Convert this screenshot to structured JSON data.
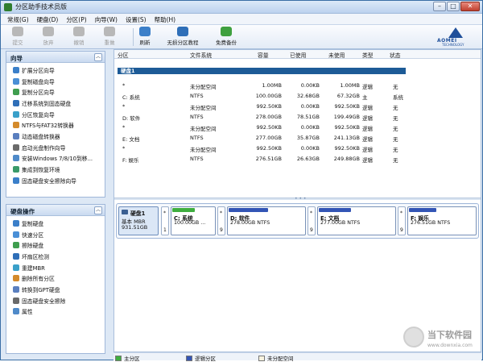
{
  "window": {
    "title": "分区助手技术员版"
  },
  "menu": [
    "常规(G)",
    "硬盘(D)",
    "分区(P)",
    "向导(W)",
    "设置(S)",
    "帮助(H)"
  ],
  "toolbar": {
    "items": [
      {
        "label": "提交",
        "icon": "check-icon",
        "enabled": false
      },
      {
        "label": "放弃",
        "icon": "discard-icon",
        "enabled": false
      },
      {
        "label": "撤销",
        "icon": "undo-icon",
        "enabled": false
      },
      {
        "label": "重做",
        "icon": "redo-icon",
        "enabled": false
      },
      {
        "label": "刷新",
        "icon": "refresh-icon",
        "enabled": true
      },
      {
        "label": "无损分区教程",
        "icon": "tutorial-icon",
        "enabled": true
      },
      {
        "label": "免费备份",
        "icon": "backup-icon",
        "enabled": true
      }
    ],
    "brand": {
      "name": "AOMEI",
      "sub": "TECHNOLOGY"
    }
  },
  "wizard_panel": {
    "title": "向导",
    "items": [
      "扩展分区向导",
      "复制磁盘向导",
      "复制分区向导",
      "迁移系统到固态硬盘",
      "分区恢复向导",
      "NTFS与FAT32转换器",
      "动态磁盘转换器",
      "启动光盘制作向导",
      "安装Windows 7/8/10到移...",
      "集成到恢复环境",
      "固态硬盘安全擦除向导"
    ]
  },
  "disk_ops_panel": {
    "title": "硬盘操作",
    "items": [
      "复制硬盘",
      "快速分区",
      "擦除硬盘",
      "坏扇区检测",
      "重建MBR",
      "删除所有分区",
      "转换到GPT硬盘",
      "固态硬盘安全擦除",
      "属性"
    ]
  },
  "table": {
    "headers": [
      "分区",
      "文件系统",
      "容量",
      "已使用",
      "未使用",
      "类型",
      "状态"
    ],
    "disk_label": "硬盘1",
    "rows": [
      {
        "partition": "*",
        "fs": "未分配空间",
        "capacity": "1.00MB",
        "used": "0.00KB",
        "unused": "1.00MB",
        "type": "逻辑",
        "status": "无"
      },
      {
        "partition": "C: 系统",
        "fs": "NTFS",
        "capacity": "100.00GB",
        "used": "32.68GB",
        "unused": "67.32GB",
        "type": "主",
        "status": "系统"
      },
      {
        "partition": "*",
        "fs": "未分配空间",
        "capacity": "992.50KB",
        "used": "0.00KB",
        "unused": "992.50KB",
        "type": "逻辑",
        "status": "无"
      },
      {
        "partition": "D: 软件",
        "fs": "NTFS",
        "capacity": "278.00GB",
        "used": "78.51GB",
        "unused": "199.49GB",
        "type": "逻辑",
        "status": "无"
      },
      {
        "partition": "*",
        "fs": "未分配空间",
        "capacity": "992.50KB",
        "used": "0.00KB",
        "unused": "992.50KB",
        "type": "逻辑",
        "status": "无"
      },
      {
        "partition": "E: 文档",
        "fs": "NTFS",
        "capacity": "277.00GB",
        "used": "35.87GB",
        "unused": "241.13GB",
        "type": "逻辑",
        "status": "无"
      },
      {
        "partition": "*",
        "fs": "未分配空间",
        "capacity": "992.50KB",
        "used": "0.00KB",
        "unused": "992.50KB",
        "type": "逻辑",
        "status": "无"
      },
      {
        "partition": "F: 娱乐",
        "fs": "NTFS",
        "capacity": "276.51GB",
        "used": "26.63GB",
        "unused": "249.88GB",
        "type": "逻辑",
        "status": "无"
      }
    ]
  },
  "disk_map": {
    "disk_name": "硬盘1",
    "disk_type": "基本 MBR",
    "disk_size": "931.51GB",
    "unalloc_top": "*",
    "unalloc_num_1": "1",
    "unalloc_num_9": "9",
    "partitions": [
      {
        "name": "C: 系统",
        "size": "100.00GB ...",
        "fill": 0.33,
        "color": "#3fae3f"
      },
      {
        "name": "D: 软件",
        "size": "278.00GB NTFS",
        "fill": 0.28,
        "color": "#3355b5"
      },
      {
        "name": "E: 文档",
        "size": "277.00GB NTFS",
        "fill": 0.13,
        "color": "#3355b5"
      },
      {
        "name": "F: 娱乐",
        "size": "276.51GB NTFS",
        "fill": 0.1,
        "color": "#3355b5"
      }
    ]
  },
  "legend": [
    {
      "label": "主分区",
      "color": "#3fae3f"
    },
    {
      "label": "逻辑分区",
      "color": "#3355b5"
    },
    {
      "label": "未分配空间",
      "color": "#f7f3df"
    }
  ],
  "watermark": {
    "text": "当下软件园",
    "url": "www.downxia.com"
  }
}
